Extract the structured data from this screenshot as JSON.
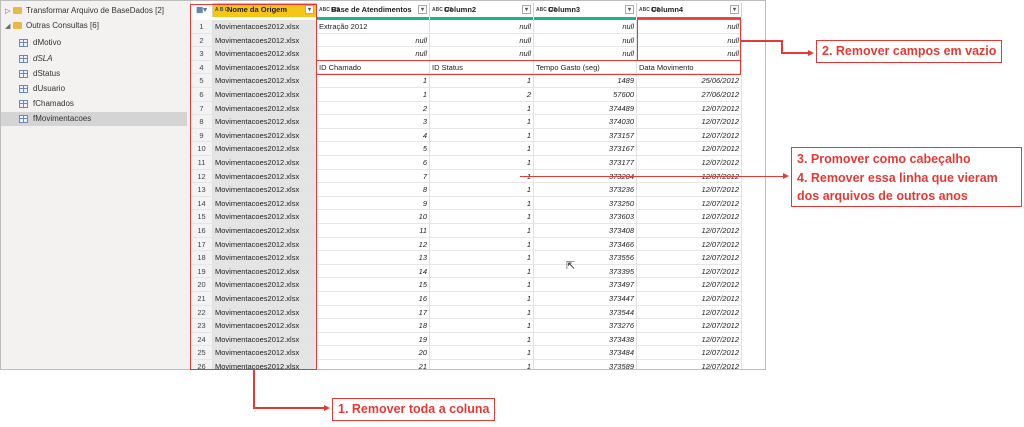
{
  "navigator": {
    "items": [
      {
        "label": "Transformar Arquivo de BaseDados [2]",
        "kind": "folder",
        "collapsed": true
      },
      {
        "label": "Outras Consultas [6]",
        "kind": "folder",
        "collapsed": false
      },
      {
        "label": "dMotivo",
        "kind": "table"
      },
      {
        "label": "dSLA",
        "kind": "table",
        "italic": true
      },
      {
        "label": "dStatus",
        "kind": "table"
      },
      {
        "label": "dUsuario",
        "kind": "table"
      },
      {
        "label": "fChamados",
        "kind": "table"
      },
      {
        "label": "fMovimentacoes",
        "kind": "table",
        "selected": true
      }
    ]
  },
  "grid": {
    "columns": [
      {
        "name": "Nome da Origem",
        "type": "A B C",
        "selected": true
      },
      {
        "name": "Base de Atendimentos",
        "type": "ABC 123"
      },
      {
        "name": "Column2",
        "type": "ABC 123"
      },
      {
        "name": "Column3",
        "type": "ABC 123"
      },
      {
        "name": "Column4",
        "type": "ABC 123"
      }
    ],
    "rows": [
      [
        "1",
        "Movimentacoes2012.xlsx",
        "Extração 2012",
        "null",
        "null",
        "null"
      ],
      [
        "2",
        "Movimentacoes2012.xlsx",
        "null",
        "null",
        "null",
        "null"
      ],
      [
        "3",
        "Movimentacoes2012.xlsx",
        "null",
        "null",
        "null",
        "null"
      ],
      [
        "4",
        "Movimentacoes2012.xlsx",
        "ID Chamado",
        "ID Status",
        "Tempo Gasto (seg)",
        "Data Movimento"
      ],
      [
        "5",
        "Movimentacoes2012.xlsx",
        "1",
        "1",
        "1489",
        "25/06/2012"
      ],
      [
        "6",
        "Movimentacoes2012.xlsx",
        "1",
        "2",
        "57600",
        "27/06/2012"
      ],
      [
        "7",
        "Movimentacoes2012.xlsx",
        "2",
        "1",
        "374489",
        "12/07/2012"
      ],
      [
        "8",
        "Movimentacoes2012.xlsx",
        "3",
        "1",
        "374030",
        "12/07/2012"
      ],
      [
        "9",
        "Movimentacoes2012.xlsx",
        "4",
        "1",
        "373157",
        "12/07/2012"
      ],
      [
        "10",
        "Movimentacoes2012.xlsx",
        "5",
        "1",
        "373167",
        "12/07/2012"
      ],
      [
        "11",
        "Movimentacoes2012.xlsx",
        "6",
        "1",
        "373177",
        "12/07/2012"
      ],
      [
        "12",
        "Movimentacoes2012.xlsx",
        "7",
        "1",
        "373204",
        "12/07/2012"
      ],
      [
        "13",
        "Movimentacoes2012.xlsx",
        "8",
        "1",
        "373236",
        "12/07/2012"
      ],
      [
        "14",
        "Movimentacoes2012.xlsx",
        "9",
        "1",
        "373250",
        "12/07/2012"
      ],
      [
        "15",
        "Movimentacoes2012.xlsx",
        "10",
        "1",
        "373603",
        "12/07/2012"
      ],
      [
        "16",
        "Movimentacoes2012.xlsx",
        "11",
        "1",
        "373408",
        "12/07/2012"
      ],
      [
        "17",
        "Movimentacoes2012.xlsx",
        "12",
        "1",
        "373466",
        "12/07/2012"
      ],
      [
        "18",
        "Movimentacoes2012.xlsx",
        "13",
        "1",
        "373556",
        "12/07/2012"
      ],
      [
        "19",
        "Movimentacoes2012.xlsx",
        "14",
        "1",
        "373395",
        "12/07/2012"
      ],
      [
        "20",
        "Movimentacoes2012.xlsx",
        "15",
        "1",
        "373497",
        "12/07/2012"
      ],
      [
        "21",
        "Movimentacoes2012.xlsx",
        "16",
        "1",
        "373447",
        "12/07/2012"
      ],
      [
        "22",
        "Movimentacoes2012.xlsx",
        "17",
        "1",
        "373544",
        "12/07/2012"
      ],
      [
        "23",
        "Movimentacoes2012.xlsx",
        "18",
        "1",
        "373276",
        "12/07/2012"
      ],
      [
        "24",
        "Movimentacoes2012.xlsx",
        "19",
        "1",
        "373438",
        "12/07/2012"
      ],
      [
        "25",
        "Movimentacoes2012.xlsx",
        "20",
        "1",
        "373484",
        "12/07/2012"
      ],
      [
        "26",
        "Movimentacoes2012.xlsx",
        "21",
        "1",
        "373589",
        "12/07/2012"
      ]
    ]
  },
  "annotations": {
    "callout1": "1. Remover toda a coluna",
    "callout2": "2. Remover campos em vazio",
    "callout3_line1": "3. Promover como cabeçalho",
    "callout3_line2": "4. Remover essa linha que vieram",
    "callout3_line3": "dos arquivos de outros anos"
  },
  "colors": {
    "accent": "#e53935",
    "selected_header": "#f5c518",
    "quality_bar": "#19b394"
  }
}
